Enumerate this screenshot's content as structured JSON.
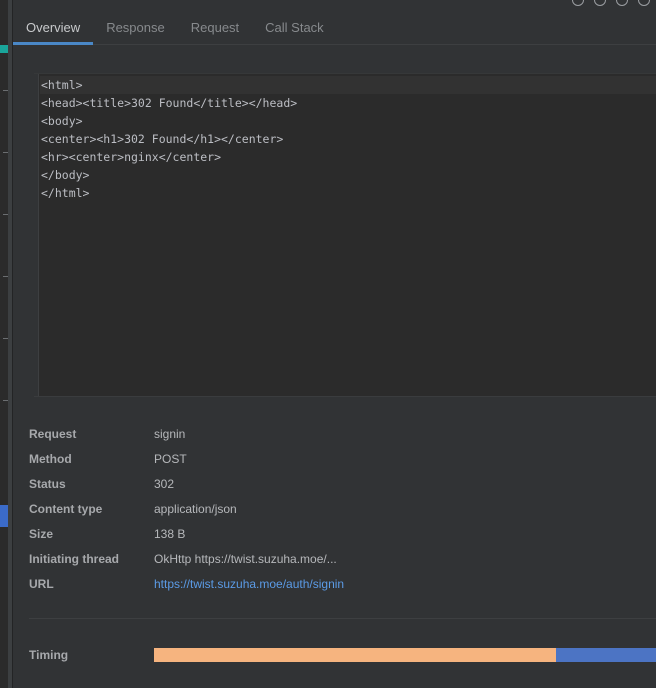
{
  "tabs": [
    {
      "label": "Overview",
      "active": true
    },
    {
      "label": "Response",
      "active": false
    },
    {
      "label": "Request",
      "active": false
    },
    {
      "label": "Call Stack",
      "active": false
    }
  ],
  "code": {
    "lines": [
      "<html>",
      "<head><title>302 Found</title></head>",
      "<body>",
      "<center><h1>302 Found</h1></center>",
      "<hr><center>nginx</center>",
      "</body>",
      "</html>"
    ]
  },
  "details": {
    "request_label": "Request",
    "request_value": "signin",
    "method_label": "Method",
    "method_value": "POST",
    "status_label": "Status",
    "status_value": "302",
    "content_type_label": "Content type",
    "content_type_value": "application/json",
    "size_label": "Size",
    "size_value": "138 B",
    "initiating_thread_label": "Initiating thread",
    "initiating_thread_value": "OkHttp https://twist.suzuha.moe/...",
    "url_label": "URL",
    "url_value": "https://twist.suzuha.moe/auth/signin"
  },
  "timing": {
    "label": "Timing",
    "waiting_fraction": 0.8,
    "colors": {
      "waiting": "#f6b47f",
      "download": "#4c74c4"
    }
  },
  "colors": {
    "accent": "#4a88c7",
    "link": "#5b9be6"
  },
  "icons": [
    "toolbar-icon",
    "toolbar-icon",
    "toolbar-icon",
    "toolbar-icon"
  ]
}
